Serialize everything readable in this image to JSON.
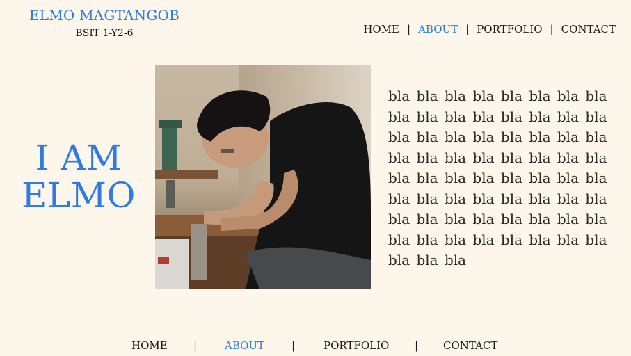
{
  "brand": {
    "name": "ELMO MAGTANGOB",
    "subtitle": "BSIT 1-Y2-6"
  },
  "nav": {
    "items": [
      "HOME",
      "ABOUT",
      "PORTFOLIO",
      "CONTACT"
    ],
    "active": "ABOUT",
    "separator": "|"
  },
  "hero": {
    "line1": "I AM",
    "line2": "ELMO"
  },
  "about": {
    "paragraph": "bla bla bla bla bla bla bla bla bla bla bla bla bla bla bla bla bla bla bla bla bla bla bla bla bla bla bla bla bla bla bla bla bla bla bla bla bla bla bla bla bla bla bla bla bla bla bla bla bla bla bla bla bla bla bla bla bla bla bla bla bla bla bla bla bla bla bla",
    "photo": "photo of Elmo at a workbench"
  },
  "colors": {
    "accent": "#2f7be0",
    "background": "#fdf6ea",
    "text": "#1a1a1a"
  }
}
